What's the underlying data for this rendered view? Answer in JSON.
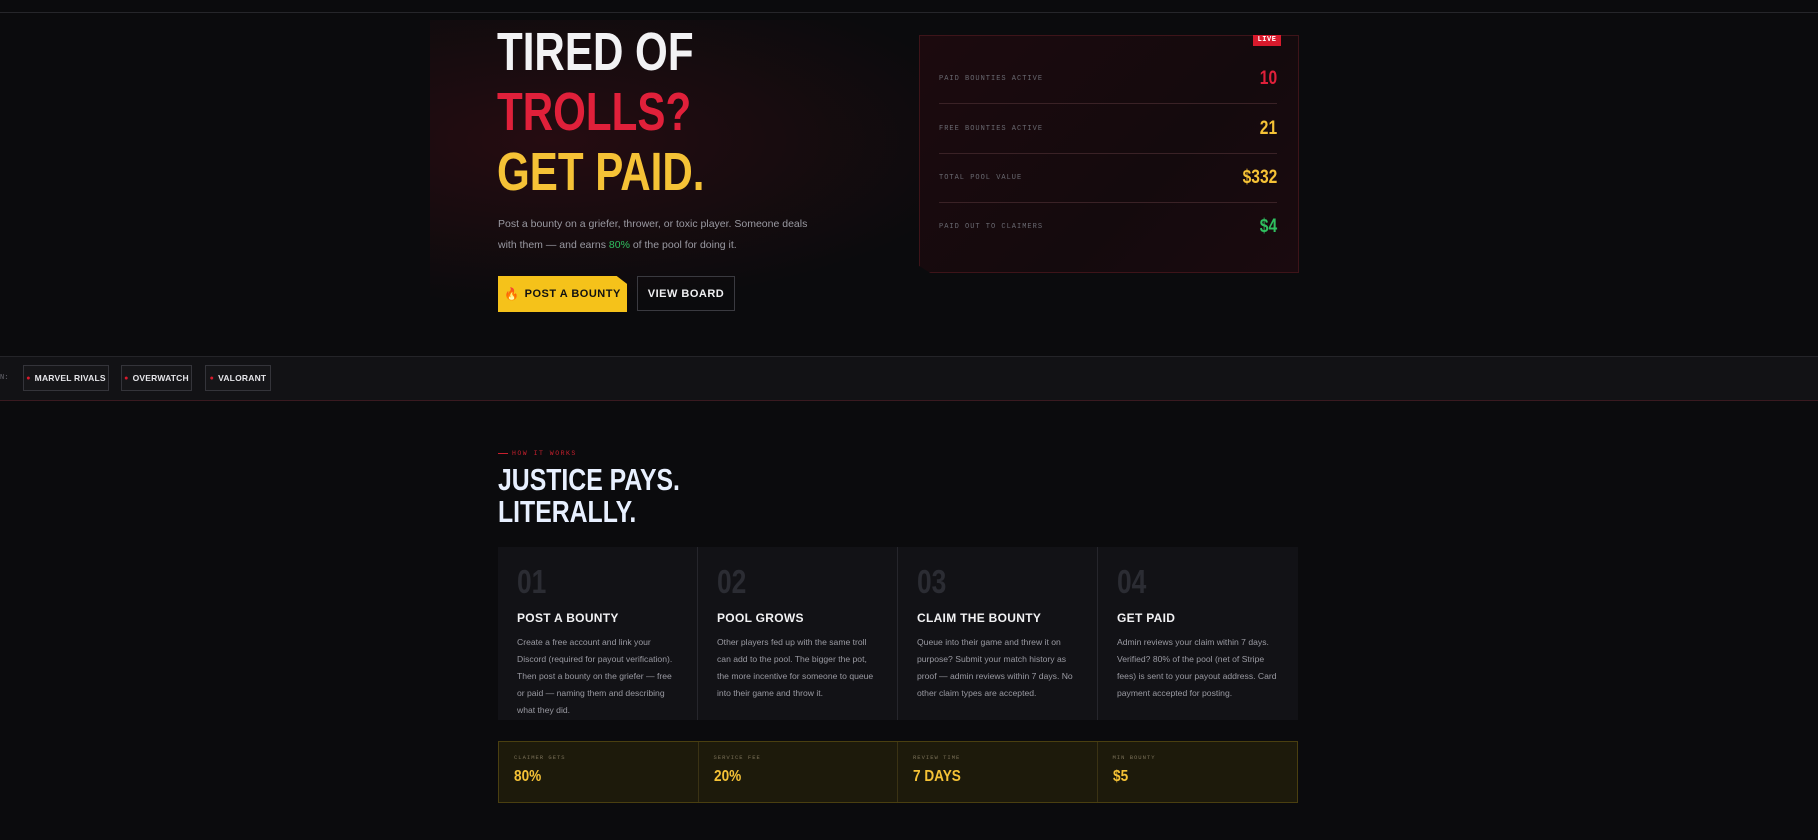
{
  "hero": {
    "line1": "TIRED OF",
    "line2": "TROLLS?",
    "line3": "GET PAID.",
    "desc_before": "Post a bounty on a griefer, thrower, or toxic player. Someone deals with them — and earns ",
    "desc_highlight": "80%",
    "desc_after": " of the pool for doing it.",
    "primary_button": "POST A BOUNTY",
    "primary_icon": "flame-icon",
    "secondary_button": "VIEW BOARD"
  },
  "stats": {
    "badge": "LIVE",
    "rows": [
      {
        "label": "PAID BOUNTIES ACTIVE",
        "value": "10",
        "color": "#e0203a"
      },
      {
        "label": "FREE BOUNTIES ACTIVE",
        "value": "21",
        "color": "#f5c236"
      },
      {
        "label": "TOTAL POOL VALUE",
        "value": "$332",
        "color": "#f5c236"
      },
      {
        "label": "PAID OUT TO CLAIMERS",
        "value": "$4",
        "color": "#2fbf5f"
      }
    ]
  },
  "games": {
    "label": "N:",
    "chips": [
      "MARVEL RIVALS",
      "OVERWATCH",
      "VALORANT"
    ]
  },
  "how": {
    "eyebrow": "HOW IT WORKS",
    "title_line1": "JUSTICE PAYS.",
    "title_line2": "LITERALLY.",
    "steps": [
      {
        "num": "01",
        "title": "POST A BOUNTY",
        "body": "Create a free account and link your Discord (required for payout verification). Then post a bounty on the griefer — free or paid — naming them and describing what they did."
      },
      {
        "num": "02",
        "title": "POOL GROWS",
        "body": "Other players fed up with the same troll can add to the pool. The bigger the pot, the more incentive for someone to queue into their game and throw it."
      },
      {
        "num": "03",
        "title": "CLAIM THE BOUNTY",
        "body": "Queue into their game and threw it on purpose? Submit your match history as proof — admin reviews within 7 days. No other claim types are accepted."
      },
      {
        "num": "04",
        "title": "GET PAID",
        "body": "Admin reviews your claim within 7 days. Verified? 80% of the pool (net of Stripe fees) is sent to your payout address. Card payment accepted for posting."
      }
    ]
  },
  "fees": [
    {
      "label": "CLAIMER GETS",
      "value": "80%"
    },
    {
      "label": "SERVICE FEE",
      "value": "20%"
    },
    {
      "label": "REVIEW TIME",
      "value": "7 DAYS"
    },
    {
      "label": "MIN BOUNTY",
      "value": "$5"
    }
  ]
}
